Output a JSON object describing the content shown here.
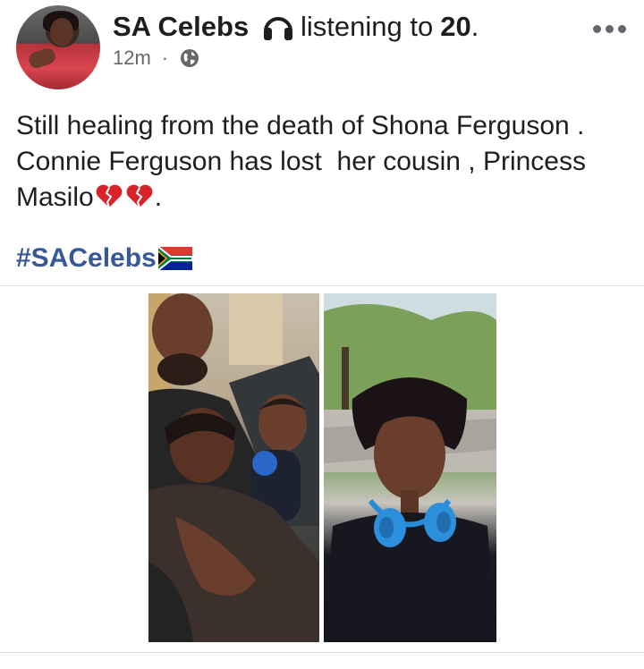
{
  "post": {
    "author": "SA Celebs",
    "activity_prefix": "listening to",
    "activity_target": "20",
    "activity_suffix": ".",
    "timestamp": "12m",
    "separator": "·",
    "privacy_icon": "globe-icon",
    "menu_icon": "more-options-icon",
    "text_lines": [
      "Still healing from the death of Shona Ferguson .",
      "Connie Ferguson has lost  her cousin , Princess",
      "Masilo"
    ],
    "text_end": ".",
    "hashtag": "#SACelebs",
    "emoji": [
      "broken-heart-icon",
      "broken-heart-icon",
      "south-africa-flag-icon"
    ]
  },
  "colors": {
    "text": "#1c1e21",
    "meta": "#65676b",
    "hashtag": "#385898",
    "divider": "#dadde1"
  },
  "images": [
    {
      "name": "family-photo"
    },
    {
      "name": "woman-with-headphones-photo"
    }
  ]
}
